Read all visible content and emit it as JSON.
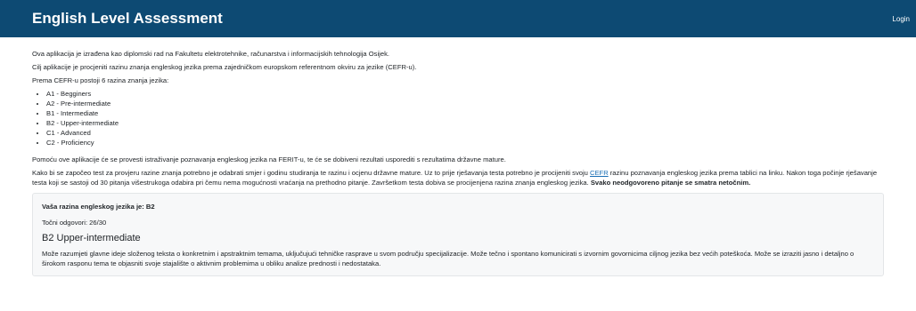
{
  "navbar": {
    "brand": "English Level Assessment",
    "login": "Login"
  },
  "intro": {
    "line1": "Ova aplikacija je izrađena kao diplomski rad na Fakultetu elektrotehnike, računarstva i informacijskih tehnologija Osijek.",
    "line2": "Cilj aplikacije je procjeniti razinu znanja engleskog jezika prema zajedničkom europskom referentnom okviru za jezike (CEFR-u).",
    "line3": "Prema CEFR-u postoji 6 razina znanja jezika:"
  },
  "levels": [
    "A1 - Begginers",
    "A2 - Pre-intermediate",
    "B1 - Intermediate",
    "B2 - Upper-intermediate",
    "C1 - Advanced",
    "C2 - Proficiency"
  ],
  "research": "Pomoću ove aplikacije će se provesti istraživanje poznavanja engleskog jezika na FERIT-u, te će se dobiveni rezultati usporediti s rezultatima državne mature.",
  "instructions": {
    "before_link": "Kako bi se započeo test za provjeru razine znanja potrebno je odabrati smjer i godinu studiranja te razinu i ocjenu državne mature. Uz to prije rješavanja testa potrebno je procijeniti svoju ",
    "link": "CEFR",
    "after_link": " razinu poznavanja engleskog jezika prema tablici na linku. Nakon toga počinje rješavanje testa koji se sastoji od 30 pitanja višestrukoga odabira pri čemu nema mogućnosti vraćanja na prethodno pitanje. Završetkom testa dobiva se procijenjena razina znanja engleskog jezika. ",
    "bold": "Svako neodgovoreno pitanje se smatra netočnim."
  },
  "result": {
    "title": "Vaša razina engleskog jezika je: B2",
    "correct": "Točni odgovori: 26/30",
    "level_name": "B2 Upper-intermediate",
    "description": "Može razumjeti glavne ideje složenog teksta o konkretnim i apstraktnim temama, uključujući tehničke rasprave u svom području specijalizacije. Može tečno i spontano komunicirati s izvornim govornicima ciljnog jezika bez većih poteškoća. Može se izraziti jasno i detaljno o širokom rasponu tema te objasniti svoje stajalište o aktivnim problemima u obliku analize prednosti i nedostataka."
  }
}
